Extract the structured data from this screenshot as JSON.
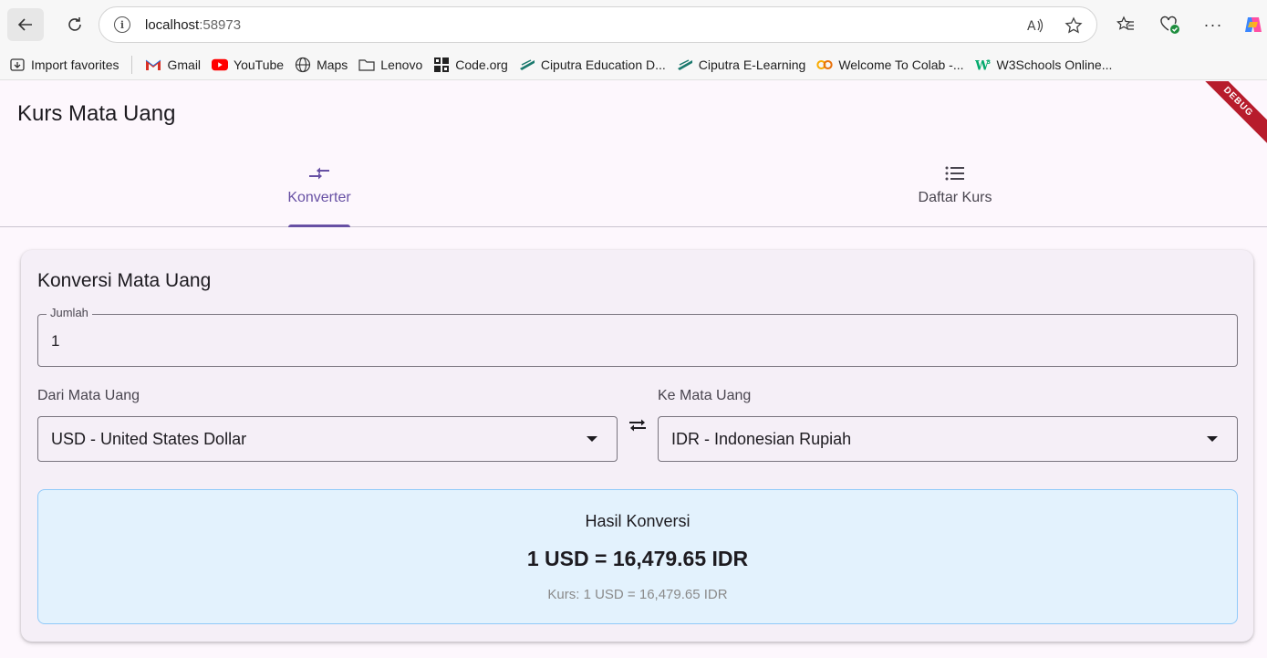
{
  "browser": {
    "url_host": "localhost",
    "url_port": ":58973",
    "bookmarks": [
      {
        "label": "Import favorites",
        "icon": "import-icon"
      },
      {
        "label": "Gmail",
        "icon": "gmail-icon"
      },
      {
        "label": "YouTube",
        "icon": "youtube-icon"
      },
      {
        "label": "Maps",
        "icon": "globe-icon"
      },
      {
        "label": "Lenovo",
        "icon": "folder-icon"
      },
      {
        "label": "Code.org",
        "icon": "code-org-icon"
      },
      {
        "label": "Ciputra Education D...",
        "icon": "ciputra-icon"
      },
      {
        "label": "Ciputra E-Learning",
        "icon": "ciputra-icon"
      },
      {
        "label": "Welcome To Colab -...",
        "icon": "colab-icon"
      },
      {
        "label": "W3Schools Online...",
        "icon": "w3schools-icon"
      }
    ]
  },
  "app": {
    "title": "Kurs Mata Uang",
    "debug_banner": "DEBUG",
    "tabs": [
      {
        "label": "Konverter",
        "icon": "compare-arrows-icon",
        "active": true
      },
      {
        "label": "Daftar Kurs",
        "icon": "list-icon",
        "active": false
      }
    ]
  },
  "converter": {
    "card_title": "Konversi Mata Uang",
    "amount_label": "Jumlah",
    "amount_value": "1",
    "from_label": "Dari Mata Uang",
    "from_value": "USD - United States Dollar",
    "to_label": "Ke Mata Uang",
    "to_value": "IDR - Indonesian Rupiah",
    "result_title": "Hasil Konversi",
    "result_main": "1 USD = 16,479.65 IDR",
    "result_rate": "Kurs: 1 USD = 16,479.65 IDR"
  },
  "colors": {
    "primary": "#6750a4",
    "result_bg": "#e3f2fd",
    "result_border": "#90caf9",
    "debug": "#b71c2c"
  }
}
